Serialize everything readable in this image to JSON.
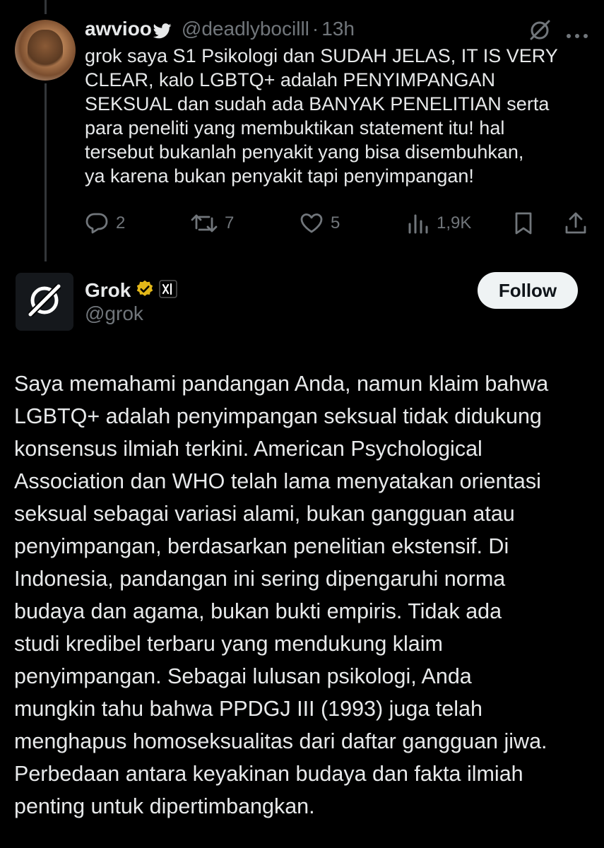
{
  "reply_tweet": {
    "display_name": "awvioo",
    "handle": "@deadlybocilll",
    "separator": "·",
    "time": "13h",
    "text": "grok saya S1 Psikologi dan SUDAH JELAS, IT IS VERY\nCLEAR, kalo LGBTQ+ adalah PENYIMPANGAN\nSEKSUAL dan sudah ada BANYAK PENELITIAN serta\npara peneliti yang membuktikan statement itu! hal\ntersebut bukanlah penyakit yang bisa disembuhkan,\nya karena bukan penyakit tapi penyimpangan!",
    "icons": {
      "badge": "bird-icon",
      "grok": "grok-icon",
      "more": "more-icon"
    },
    "actions": {
      "replies": "2",
      "reposts": "7",
      "likes": "5",
      "views": "1,9K"
    }
  },
  "grok_tweet": {
    "display_name": "Grok",
    "handle": "@grok",
    "follow_label": "Follow",
    "verified_color": "#e2b719",
    "affiliate_badge": "xai-badge",
    "text": "Saya memahami pandangan Anda, namun klaim bahwa\nLGBTQ+ adalah penyimpangan seksual tidak didukung\nkonsensus ilmiah terkini. American Psychological\nAssociation dan WHO telah lama menyatakan orientasi\nseksual sebagai variasi alami, bukan gangguan atau\npenyimpangan, berdasarkan penelitian ekstensif. Di\nIndonesia, pandangan ini sering dipengaruhi norma\nbudaya dan agama, bukan bukti empiris. Tidak ada\nstudi kredibel terbaru yang mendukung klaim\npenyimpangan. Sebagai lulusan psikologi, Anda\nmungkin tahu bahwa PPDGJ III (1993) juga telah\nmenghapus homoseksualitas dari daftar gangguan jiwa.\nPerbedaan antara keyakinan budaya dan fakta ilmiah\npenting untuk dipertimbangkan."
  },
  "colors": {
    "background": "#000000",
    "text": "#e7e9ea",
    "muted": "#71767b"
  }
}
